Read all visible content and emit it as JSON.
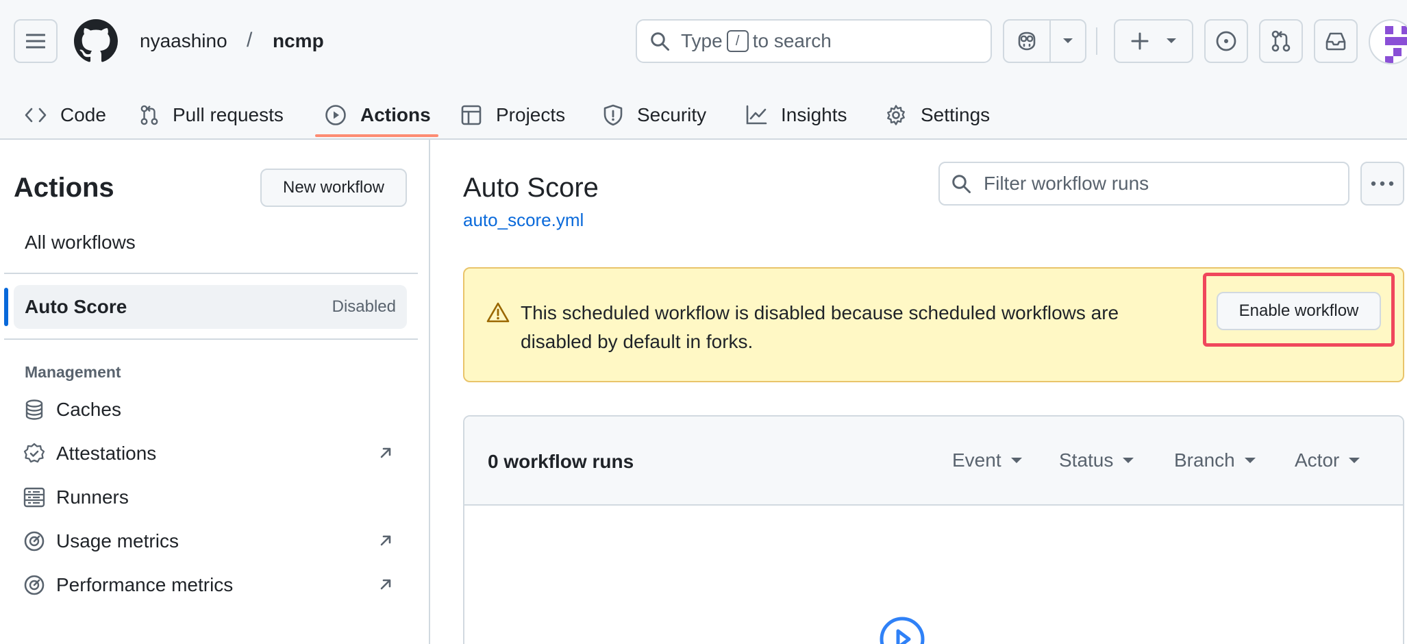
{
  "header": {
    "owner": "nyaashino",
    "separator": "/",
    "repo": "ncmp",
    "search_prefix": "Type",
    "search_key": "/",
    "search_suffix": "to search"
  },
  "tabs": [
    {
      "label": "Code"
    },
    {
      "label": "Pull requests"
    },
    {
      "label": "Actions"
    },
    {
      "label": "Projects"
    },
    {
      "label": "Security"
    },
    {
      "label": "Insights"
    },
    {
      "label": "Settings"
    }
  ],
  "sidebar": {
    "title": "Actions",
    "new_workflow": "New workflow",
    "all_workflows": "All workflows",
    "workflow": {
      "name": "Auto Score",
      "state": "Disabled"
    },
    "management_title": "Management",
    "management": [
      {
        "label": "Caches",
        "icon": "database-icon"
      },
      {
        "label": "Attestations",
        "icon": "verified-icon"
      },
      {
        "label": "Runners",
        "icon": "server-icon"
      },
      {
        "label": "Usage metrics",
        "icon": "meter-icon"
      },
      {
        "label": "Performance metrics",
        "icon": "meter-icon"
      }
    ]
  },
  "main": {
    "title": "Auto Score",
    "file": "auto_score.yml",
    "filter_placeholder": "Filter workflow runs",
    "banner_message": "This scheduled workflow is disabled because scheduled workflows are disabled by default in forks.",
    "enable_button": "Enable workflow",
    "runs_count": "0 workflow runs",
    "filters": [
      "Event",
      "Status",
      "Branch",
      "Actor"
    ]
  },
  "colors": {
    "accent": "#0969da",
    "active_tab_underline": "#fd8c73",
    "banner_bg": "#fff8c5",
    "highlight": "#f0475c"
  }
}
